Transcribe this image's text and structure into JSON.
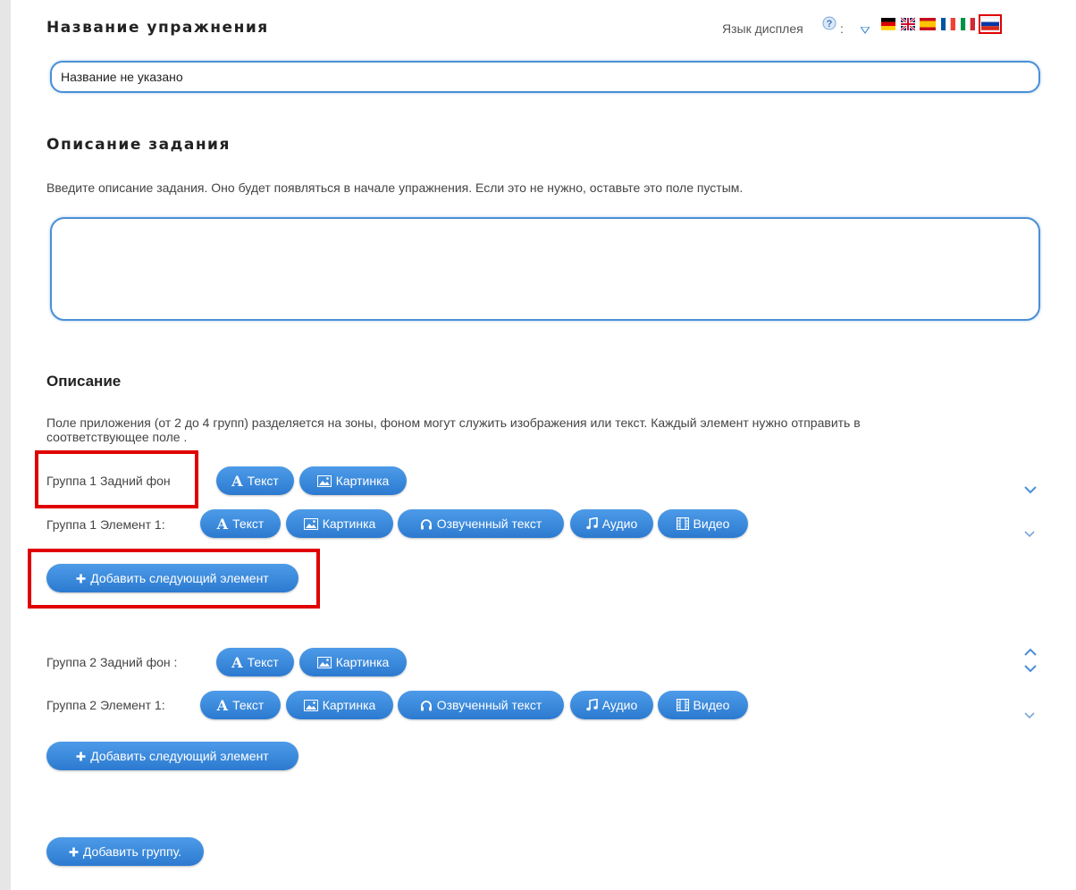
{
  "header": {
    "title": "Название упражнения",
    "language_label": "Язык дисплея",
    "language_colon": ":"
  },
  "title_input": {
    "value": "Название не указано"
  },
  "task": {
    "heading": "Описание задания",
    "hint": "Введите описание задания. Оно будет появляться в начале упражнения. Если это не нужно, оставьте это поле пустым.",
    "value": ""
  },
  "description": {
    "heading": "Описание",
    "text_line1": "Поле приложения (от 2 до 4 групп) разделяется на зоны, фоном могут служить изображения или текст. Каждый элемент нужно отправить в",
    "text_line2": "соответствующее поле ."
  },
  "buttons": {
    "text": "Текст",
    "image": "Картинка",
    "spoken": "Озвученный текст",
    "audio": "Аудио",
    "video": "Видео",
    "add_element": "Добавить следующий элемент",
    "add_group": "Добавить группу."
  },
  "groups": [
    {
      "bg_label": "Группа 1 Задний фон",
      "element_label": "Группа 1 Элемент 1:"
    },
    {
      "bg_label": "Группа 2 Задний фон :",
      "element_label": "Группа 2 Элемент 1:"
    }
  ],
  "icons": {
    "help": "help-icon",
    "dropdown": "triangle-down-icon",
    "flags": [
      "flag-germany-icon",
      "flag-uk-icon",
      "flag-spain-icon",
      "flag-france-icon",
      "flag-italy-icon",
      "flag-russia-icon"
    ],
    "text": "letter-a-icon",
    "image": "picture-icon",
    "spoken": "headphones-icon",
    "audio": "music-note-icon",
    "video": "film-icon",
    "plus": "plus-icon",
    "chevron_down": "chevron-down-icon",
    "chevron_up": "chevron-up-icon"
  },
  "colors": {
    "accent": "#2c7ad0",
    "field_border": "#4a8fd6",
    "highlight": "#e00000"
  }
}
